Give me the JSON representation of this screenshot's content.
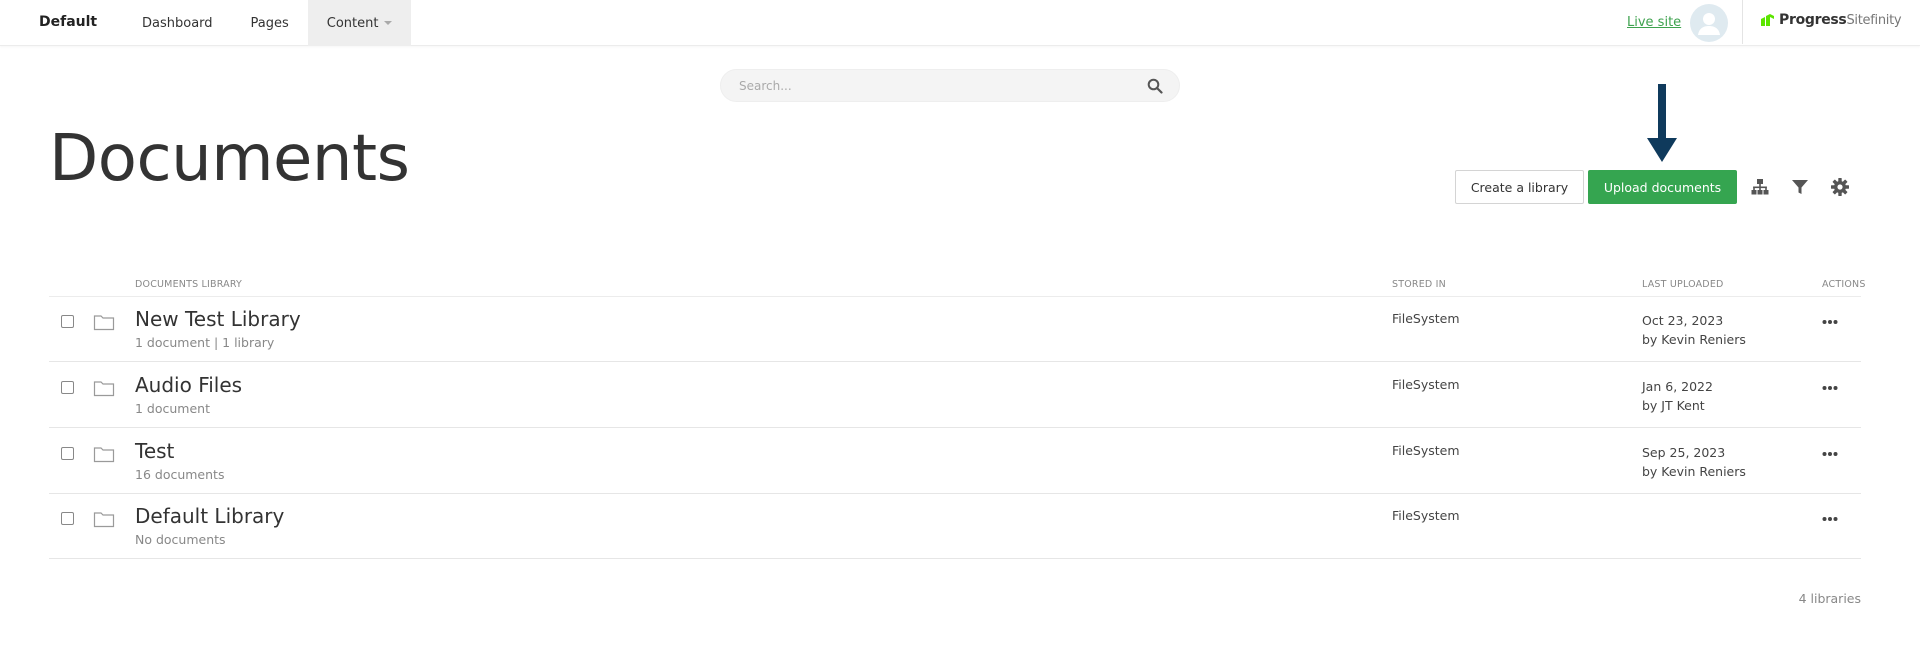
{
  "topbar": {
    "site_name": "Default",
    "nav": [
      {
        "label": "Dashboard"
      },
      {
        "label": "Pages"
      },
      {
        "label": "Content"
      }
    ],
    "live_site": "Live site",
    "brand_progress": "Progress",
    "brand_sitefinity": "Sitefinity"
  },
  "search": {
    "placeholder": "Search..."
  },
  "page": {
    "title": "Documents"
  },
  "toolbar": {
    "create_library": "Create a library",
    "upload_documents": "Upload documents"
  },
  "table": {
    "headers": {
      "library": "DOCUMENTS LIBRARY",
      "stored_in": "STORED IN",
      "last_uploaded": "LAST UPLOADED",
      "actions": "ACTIONS"
    },
    "rows": [
      {
        "name": "New Test Library",
        "summary": "1 document | 1 library",
        "stored_in": "FileSystem",
        "date": "Oct 23, 2023",
        "by": "by Kevin Reniers"
      },
      {
        "name": "Audio Files",
        "summary": "1 document",
        "stored_in": "FileSystem",
        "date": "Jan 6, 2022",
        "by": "by JT Kent"
      },
      {
        "name": "Test",
        "summary": "16 documents",
        "stored_in": "FileSystem",
        "date": "Sep 25, 2023",
        "by": "by Kevin Reniers"
      },
      {
        "name": "Default Library",
        "summary": "No documents",
        "stored_in": "FileSystem",
        "date": "",
        "by": ""
      }
    ]
  },
  "footer": {
    "count": "4 libraries"
  },
  "colors": {
    "accent_green": "#35a550",
    "link_green": "#3da24e",
    "arrow_navy": "#0f3a5c"
  }
}
